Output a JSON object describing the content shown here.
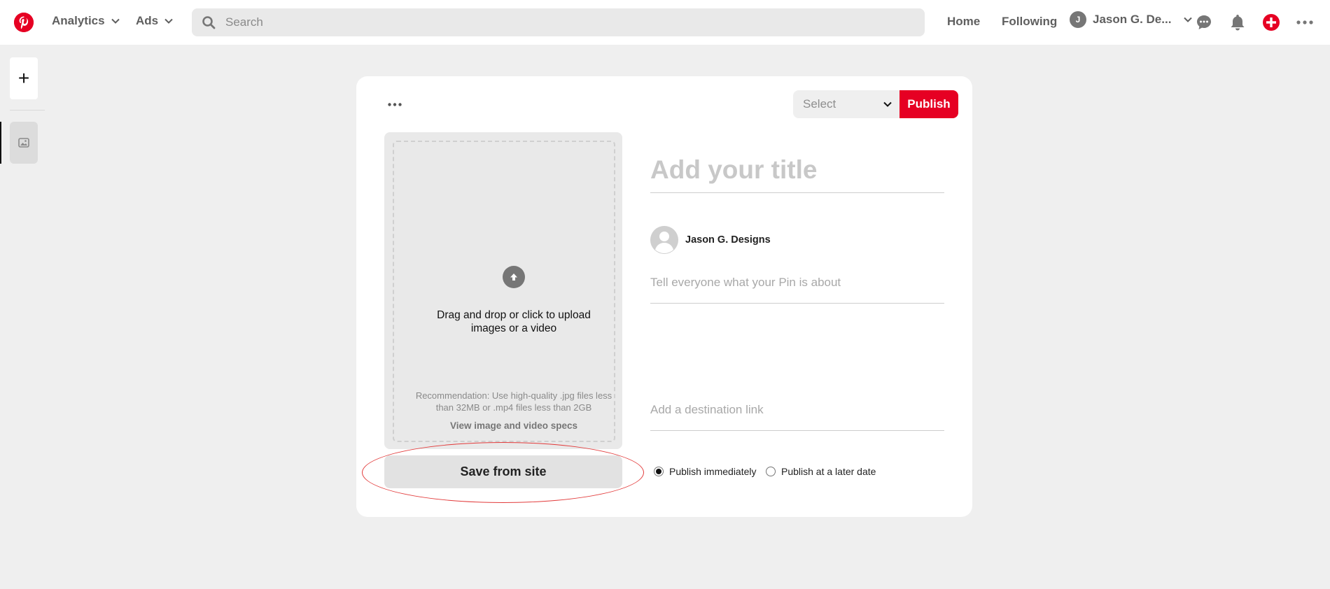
{
  "topbar": {
    "nav": [
      {
        "label": "Analytics"
      },
      {
        "label": "Ads"
      }
    ],
    "search_placeholder": "Search",
    "links": {
      "home": "Home",
      "following": "Following"
    },
    "user": {
      "initial": "J",
      "name": "Jason G. De..."
    },
    "icons": [
      "pinterest-logo-icon",
      "chevron-down-icon",
      "search-icon",
      "chat-icon",
      "bell-icon",
      "create-plus-icon",
      "more-icon"
    ],
    "brand_color": "#e60023"
  },
  "rail": {
    "add_symbol": "+",
    "icons": [
      "plus-icon",
      "image-icon"
    ]
  },
  "editor": {
    "board_select": "Select",
    "publish_label": "Publish",
    "upload": {
      "text": "Drag and drop or click to upload images or a video",
      "recommendation": "Recommendation: Use high-quality .jpg files less than 32MB or .mp4 files less than 2GB",
      "specs_link": "View image and video specs"
    },
    "save_from_site": "Save from site",
    "title_placeholder": "Add your title",
    "author_name": "Jason G. Designs",
    "description_placeholder": "Tell everyone what your Pin is about",
    "link_placeholder": "Add a destination link",
    "publish_options": [
      {
        "label": "Publish immediately",
        "selected": true
      },
      {
        "label": "Publish at a later date",
        "selected": false
      }
    ]
  }
}
